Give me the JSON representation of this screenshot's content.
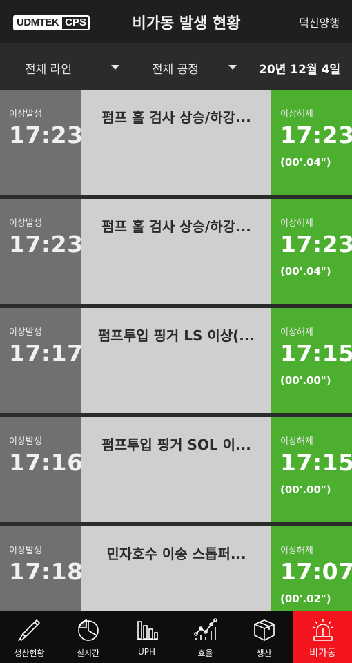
{
  "header": {
    "logo_main": "UDMTEK",
    "logo_sub": "CPS",
    "title": "비가동 발생 현황",
    "company": "덕신양행"
  },
  "filters": {
    "line": "전체 라인",
    "process": "전체 공정",
    "date": "20년 12월 4일"
  },
  "events": [
    {
      "start_label": "이상발생",
      "start_time": "17:23",
      "description": "펌프 홀 검사 상승/하강...",
      "end_label": "이상해제",
      "end_time": "17:23",
      "duration": "(00'.04\")"
    },
    {
      "start_label": "이상발생",
      "start_time": "17:23",
      "description": "펌프 홀 검사 상승/하강...",
      "end_label": "이상해제",
      "end_time": "17:23",
      "duration": "(00'.04\")"
    },
    {
      "start_label": "이상발생",
      "start_time": "17:17",
      "description": "펌프투입 핑거 LS 이상(...",
      "end_label": "이상해제",
      "end_time": "17:15",
      "duration": "(00'.00\")"
    },
    {
      "start_label": "이상발생",
      "start_time": "17:16",
      "description": "펌프투입 핑거 SOL 이...",
      "end_label": "이상해제",
      "end_time": "17:15",
      "duration": "(00'.00\")"
    },
    {
      "start_label": "이상발생",
      "start_time": "17:18",
      "description": "민자호수 이송 스톱퍼...",
      "end_label": "이상해제",
      "end_time": "17:07",
      "duration": "(00'.02\")"
    }
  ],
  "nav": [
    {
      "label": "생산현황",
      "icon": "probe-pen-icon"
    },
    {
      "label": "실시간",
      "icon": "pie-chart-icon"
    },
    {
      "label": "UPH",
      "icon": "bar-chart-icon"
    },
    {
      "label": "효율",
      "icon": "line-chart-icon"
    },
    {
      "label": "생산",
      "icon": "box-icon"
    },
    {
      "label": "비가동",
      "icon": "alarm-siren-icon",
      "active": true
    }
  ],
  "colors": {
    "active_nav": "#f2151e",
    "resolved": "#4caf30",
    "occurred": "#707070",
    "description_bg": "#cfcfcf"
  }
}
